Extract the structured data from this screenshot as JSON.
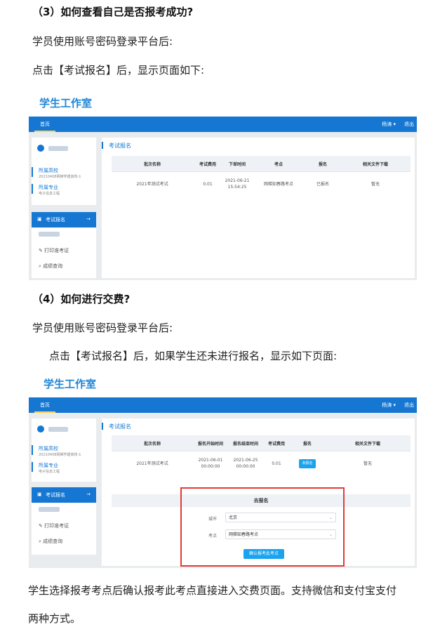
{
  "section3": {
    "heading": "（3）如何查看自己是否报考成功?",
    "line1": "学员使用账号密码登录平台后:",
    "line2": "点击【考试报名】后，显示页面如下:"
  },
  "section4": {
    "heading": "（4）如何进行交费?",
    "line1": "学员使用账号密码登录平台后:",
    "line2": "点击【考试报名】后，如果学生还未进行报名，显示如下页面:",
    "line3": "学生选择报考考点后确认报考此考点直接进入交费页面。支持微信和支付宝支付",
    "line4": "两种方式。"
  },
  "app": {
    "brand": "学生工作室",
    "nav_home": "首页",
    "user_menu": "杨涛 ▾",
    "logout": "退出",
    "school_label": "所属高校",
    "school_value": "20210408网梯学建高校-1",
    "major_label": "所属专业",
    "major_value": "电子信息工程",
    "menu_exam_signup": "考试报名",
    "menu_arrow": "→",
    "menu_print_ticket": "打印准考证",
    "menu_score_query": "成绩查询",
    "section_title": "考试报名"
  },
  "table1": {
    "headers": [
      "批次名称",
      "考试费用",
      "下单时间",
      "考点",
      "报名",
      "相关文件下载"
    ],
    "row": [
      "2021年测试考试",
      "0.01",
      "2021-06-21",
      "15:54:25",
      "网梯知春路考点",
      "已报名",
      "暂无"
    ]
  },
  "table2": {
    "headers": [
      "批次名称",
      "报名开始时间",
      "报名结束时间",
      "考试费用",
      "报名",
      "相关文件下载"
    ],
    "row": [
      "2021年测试考试",
      "2021-06-01",
      "00:00:00",
      "2021-06-25",
      "00:00:00",
      "0.01",
      "未报名",
      "暂无"
    ]
  },
  "dialog": {
    "title": "去报名",
    "city_label": "城市",
    "city_value": "北京",
    "site_label": "考点",
    "site_value": "网梯知春路考点",
    "confirm": "确认报考此考点"
  },
  "colors": {
    "brand_blue": "#1f86d6",
    "topbar_blue": "#1677d2",
    "badge_blue": "#1aa3ee",
    "frame_red": "#e53935"
  }
}
